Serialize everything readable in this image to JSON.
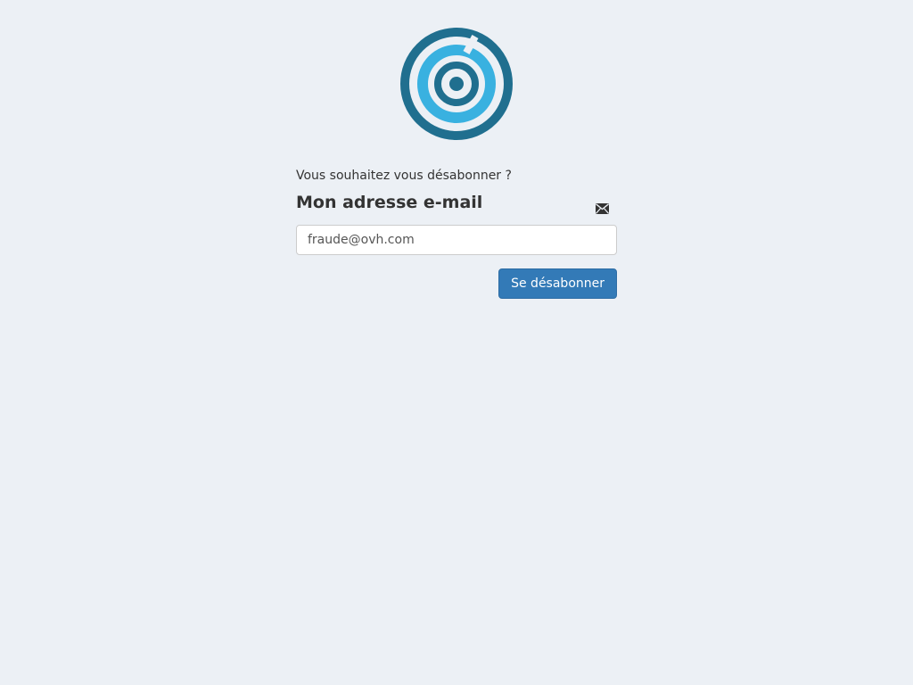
{
  "logo": {
    "icon": "target-logo-icon",
    "outer_color": "#206f8f",
    "inner_color": "#39b1e0"
  },
  "form": {
    "question": "Vous souhaitez vous désabonner ?",
    "email_label": "Mon adresse e-mail",
    "email_icon": "envelope-icon",
    "email_value": "fraude@ovh.com",
    "submit_label": "Se désabonner"
  },
  "colors": {
    "background": "#ecf0f5",
    "primary_button": "#337ab7"
  }
}
